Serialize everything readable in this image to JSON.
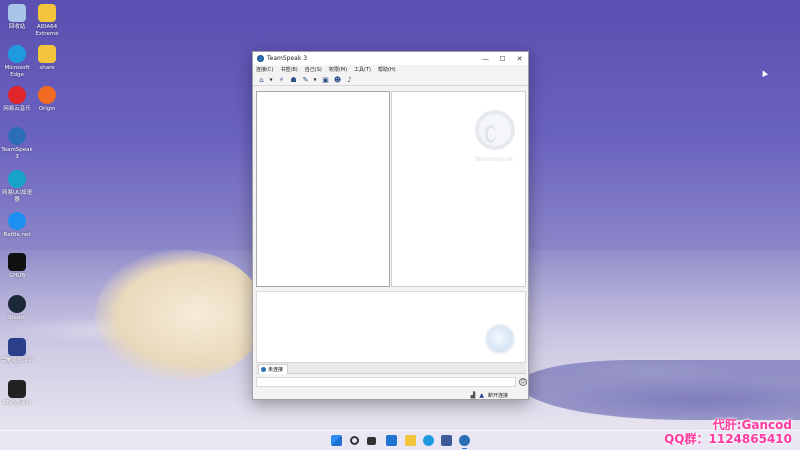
{
  "desktop": {
    "icons": [
      {
        "label": "回收站",
        "icon": "recycle-bin-icon",
        "color": "#a8c4e8"
      },
      {
        "label": "AIDA64 Extreme",
        "icon": "folder-icon",
        "color": "#f2c53d"
      },
      {
        "label": "Microsoft Edge",
        "icon": "edge-icon",
        "color": "#1e9be0"
      },
      {
        "label": "share",
        "icon": "folder-icon",
        "color": "#f2c53d"
      },
      {
        "label": "网易云音乐",
        "icon": "netease-music-icon",
        "color": "#e0262a"
      },
      {
        "label": "Origin",
        "icon": "origin-icon",
        "color": "#f26b21"
      },
      {
        "label": "TeamSpeak 3",
        "icon": "teamspeak-icon",
        "color": "#2a6fb5"
      },
      {
        "label": "网易UU加速器",
        "icon": "uu-accelerator-icon",
        "color": "#1aa3c8"
      },
      {
        "label": "Battle.net",
        "icon": "battlenet-icon",
        "color": "#1d8ff0"
      },
      {
        "label": "GHUB",
        "icon": "ghub-icon",
        "color": "#111111"
      },
      {
        "label": "Steam",
        "icon": "steam-icon",
        "color": "#1b2838"
      },
      {
        "label": "完美对战平台",
        "icon": "perfect-world-icon",
        "color": "#2b3f8a"
      },
      {
        "label": "5E对战平台",
        "icon": "5e-platform-icon",
        "color": "#222222"
      }
    ]
  },
  "window": {
    "title": "TeamSpeak 3",
    "controls": {
      "minimize": "—",
      "maximize": "☐",
      "close": "✕"
    },
    "menu": [
      "连接(C)",
      "书签(B)",
      "自己(S)",
      "权限(M)",
      "工具(T)",
      "帮助(H)"
    ],
    "toolbar": [
      "connect-icon",
      "disconnect-icon",
      "away-icon",
      "mute-icon",
      "chat-icon",
      "contacts-icon",
      "whisper-icon"
    ],
    "right_pane_logo_text": "TeamSpeak",
    "chat_tab_label": "未连接",
    "emoji": "☺",
    "status_text": "断开连接"
  },
  "taskbar": {
    "icons": [
      "start-icon",
      "search-icon",
      "task-view-icon",
      "widgets-icon",
      "explorer-icon",
      "edge-icon",
      "store-icon",
      "teamspeak-icon"
    ]
  },
  "watermark": {
    "line1": "代肝:Gancod",
    "line2": "QQ群：1124865410"
  }
}
